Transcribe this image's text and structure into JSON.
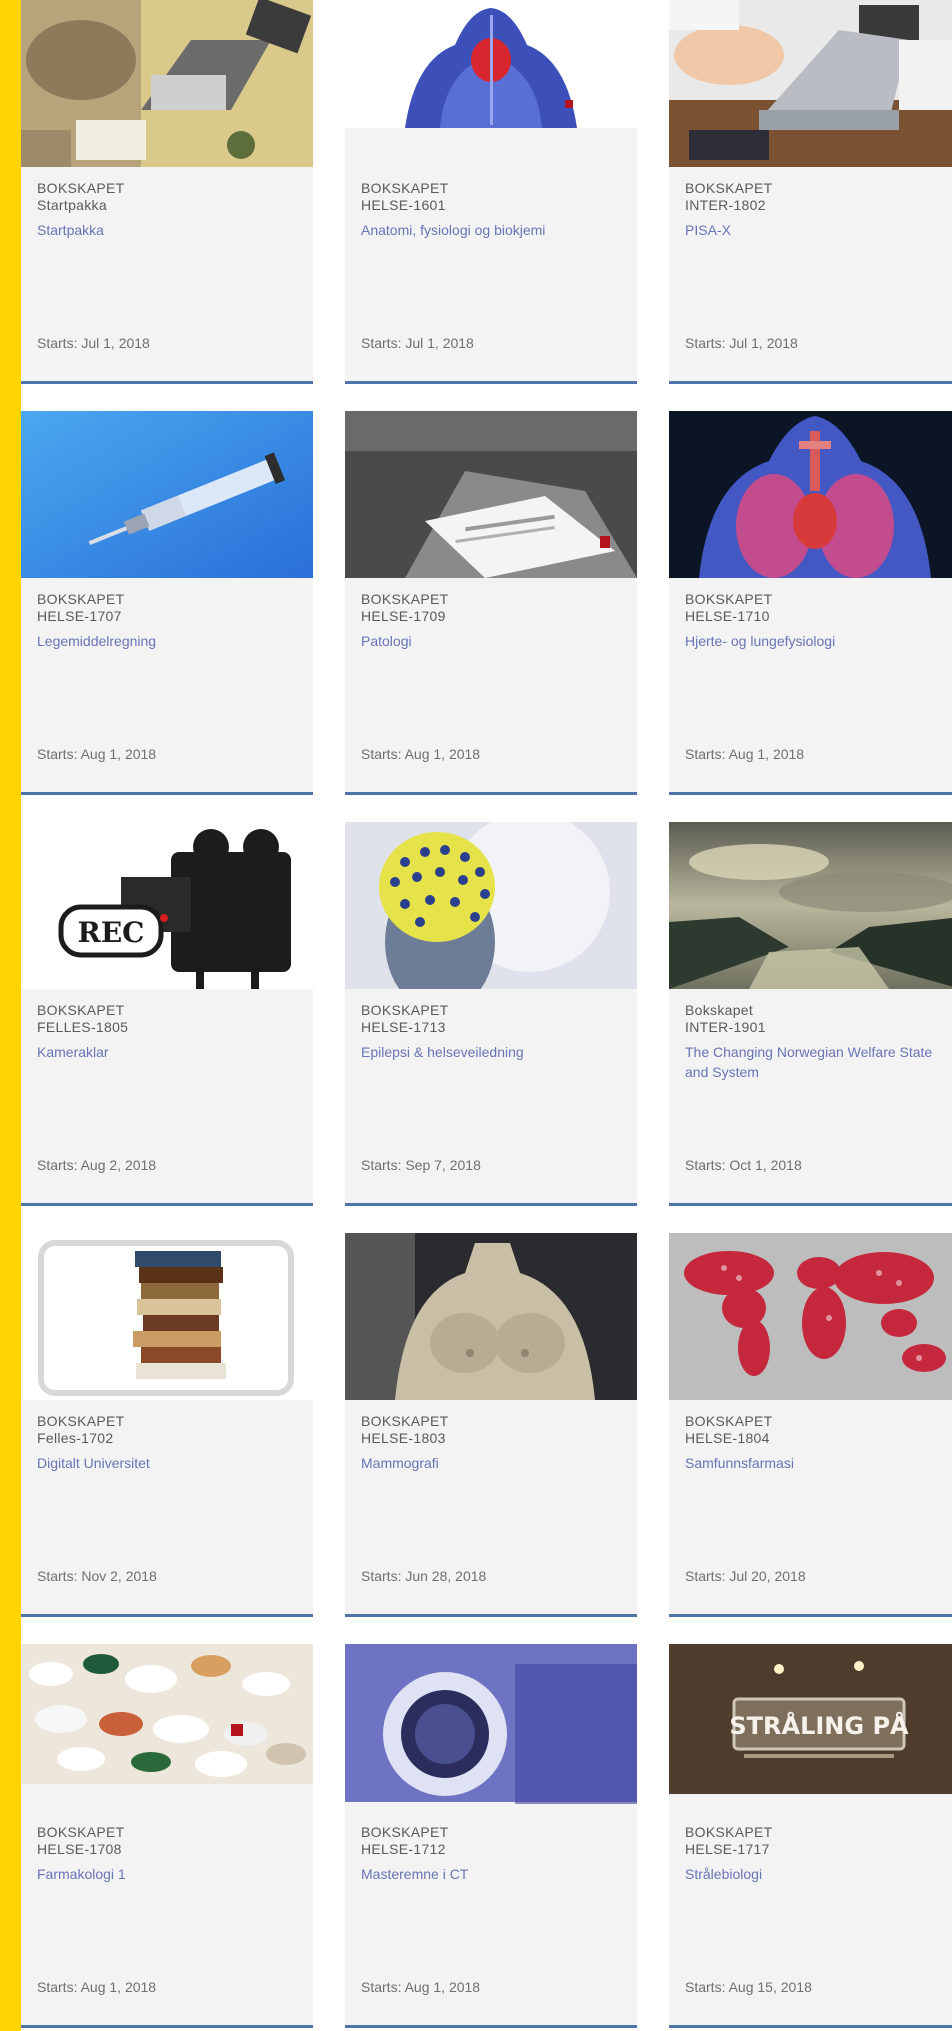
{
  "courses": [
    {
      "org": "BOKSKAPET",
      "code": "Startpakka",
      "title": "Startpakka",
      "start": "Starts: Jul 1, 2018",
      "image": "desk-laptop"
    },
    {
      "org": "BOKSKAPET",
      "code": "HELSE-1601",
      "title": "Anatomi, fysiologi og biokjemi",
      "start": "Starts: Jul 1, 2018",
      "image": "torso-anatomy"
    },
    {
      "org": "BOKSKAPET",
      "code": "INTER-1802",
      "title": "PISA-X",
      "start": "Starts: Jul 1, 2018",
      "image": "laptop-hands"
    },
    {
      "org": "BOKSKAPET",
      "code": "HELSE-1707",
      "title": "Legemiddelregning",
      "start": "Starts: Aug 1, 2018",
      "image": "syringe"
    },
    {
      "org": "BOKSKAPET",
      "code": "HELSE-1709",
      "title": "Patologi",
      "start": "Starts: Aug 1, 2018",
      "image": "lab-paper"
    },
    {
      "org": "BOKSKAPET",
      "code": "HELSE-1710",
      "title": "Hjerte- og lungefysiologi",
      "start": "Starts: Aug 1, 2018",
      "image": "heart-lungs"
    },
    {
      "org": "BOKSKAPET",
      "code": "FELLES-1805",
      "title": "Kameraklar",
      "start": "Starts: Aug 2, 2018",
      "image": "video-camera"
    },
    {
      "org": "BOKSKAPET",
      "code": "HELSE-1713",
      "title": "Epilepsi & helseveiledning",
      "start": "Starts: Sep 7, 2018",
      "image": "eeg-cap"
    },
    {
      "org": "Bokskapet",
      "code": "INTER-1901",
      "title": "The Changing Norwegian Welfare State and System",
      "start": "Starts: Oct 1, 2018",
      "image": "fjord"
    },
    {
      "org": "BOKSKAPET",
      "code": "Felles-1702",
      "title": "Digitalt Universitet",
      "start": "Starts: Nov 2, 2018",
      "image": "tablet-books"
    },
    {
      "org": "BOKSKAPET",
      "code": "HELSE-1803",
      "title": "Mammografi",
      "start": "Starts: Jun 28, 2018",
      "image": "mannequin"
    },
    {
      "org": "BOKSKAPET",
      "code": "HELSE-1804",
      "title": "Samfunnsfarmasi",
      "start": "Starts: Jul 20, 2018",
      "image": "world-map"
    },
    {
      "org": "BOKSKAPET",
      "code": "HELSE-1708",
      "title": "Farmakologi 1",
      "start": "Starts: Aug 1, 2018",
      "image": "pills"
    },
    {
      "org": "BOKSKAPET",
      "code": "HELSE-1712",
      "title": "Masteremne i CT",
      "start": "Starts: Aug 1, 2018",
      "image": "ct-scanner"
    },
    {
      "org": "BOKSKAPET",
      "code": "HELSE-1717",
      "title": "Strålebiologi",
      "start": "Starts: Aug 15, 2018",
      "image": "straling-sign"
    }
  ],
  "image_texts": {
    "video-camera": "REC",
    "straling-sign": "STRÅLING PÅ"
  },
  "colors": {
    "accent_bar": "#ffd400",
    "card_border": "#4f74a8",
    "title_link": "#6774b6"
  }
}
